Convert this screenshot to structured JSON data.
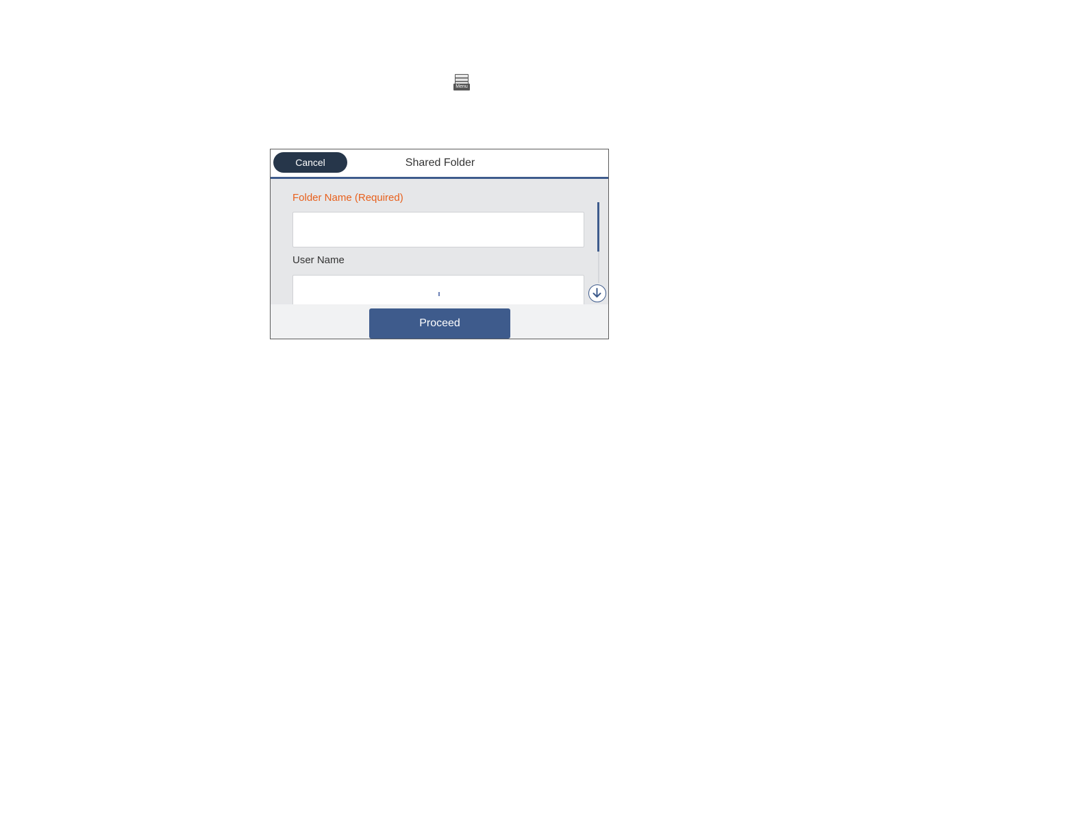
{
  "menu_icon": {
    "icon": "menu-icon",
    "label": "Menu"
  },
  "screen": {
    "header": {
      "cancel_label": "Cancel",
      "title": "Shared Folder"
    },
    "form": {
      "folder_name_label": "Folder Name (Required)",
      "folder_name_value": "",
      "user_name_label": "User Name",
      "user_name_value": ""
    },
    "scroll_down_icon": "arrow-down-circle-icon",
    "footer": {
      "proceed_label": "Proceed"
    }
  },
  "colors": {
    "accent": "#3e5b8c",
    "cancel_button": "#26364a",
    "required_label": "#e8601c",
    "screen_background": "#e6e7e9"
  }
}
